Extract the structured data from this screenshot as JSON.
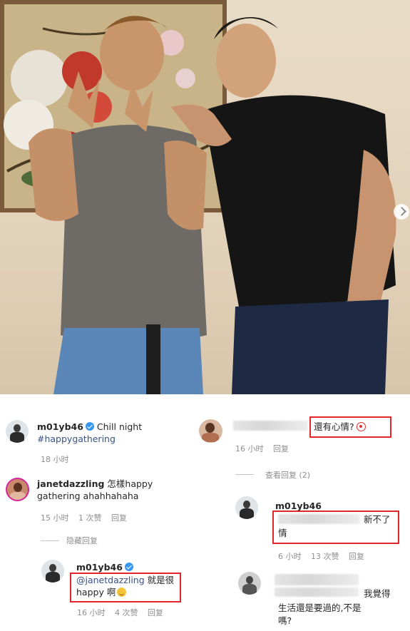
{
  "post": {
    "caption_user": "m01yb46",
    "caption_text": "Chill night",
    "hashtag": "#happygathering",
    "time": "18 小时"
  },
  "comments_left": [
    {
      "user": "janetdazzling",
      "text_line1": "怎樣happy",
      "text_line2": "gathering ahahhahaha",
      "time": "15 小时",
      "likes": "1 次赞",
      "reply": "回复"
    }
  ],
  "hide_replies_label": "隐藏回复",
  "reply_left": {
    "user": "m01yb46",
    "mention": "@janetdazzling",
    "text_line1": "就是很",
    "text_line2": "happy 啊",
    "time": "16 小时",
    "likes": "4 次赞",
    "reply": "回复"
  },
  "right_comment": {
    "text": "還有心情?",
    "time": "16 小时",
    "reply": "回复"
  },
  "view_replies_label": "查看回复 (2)",
  "right_reply": {
    "user": "m01yb46",
    "text_line1": "新不了",
    "text_line2": "情",
    "time": "6 小时",
    "likes": "13 次赞",
    "reply": "回复"
  },
  "right_last": {
    "text_line1": "我覺得",
    "text_line2": "生活還是要過的,不是",
    "text_line3": "嗎?"
  },
  "icons": {
    "verified": "verified-badge-icon",
    "next": "carousel-next-icon",
    "emoji_laugh": "laughing-emoji-icon",
    "emoji_clown": "clown-emoji-icon"
  },
  "colors": {
    "highlight": "#e3262a",
    "hashtag": "#385185",
    "verified": "#3897f0"
  }
}
